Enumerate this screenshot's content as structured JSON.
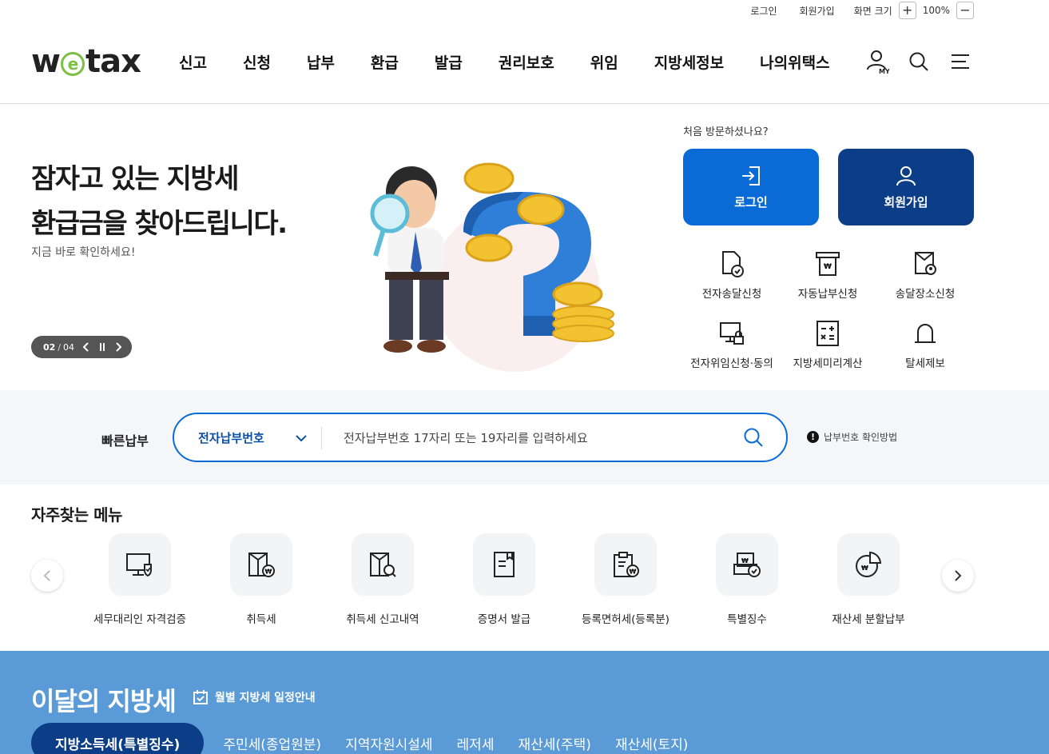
{
  "utility": {
    "login": "로그인",
    "signup": "회원가입",
    "zoom_label": "화면 크기",
    "zoom_in": "+",
    "zoom_value": "100%",
    "zoom_out": "−"
  },
  "header": {
    "logo_left": "w",
    "logo_e": "e",
    "logo_right": "tax",
    "nav": [
      "신고",
      "신청",
      "납부",
      "환급",
      "발급",
      "권리보호",
      "위임",
      "지방세정보",
      "나의위택스"
    ],
    "icons": [
      "my-page-icon",
      "search-icon",
      "menu-icon"
    ],
    "my_label": "MY"
  },
  "hero": {
    "title_line1": "잠자고 있는 지방세",
    "title_line2": "환급금을 찾아드립니다.",
    "subtitle": "지금 바로 확인하세요!",
    "pager_current": "02",
    "pager_sep": "/",
    "pager_total": "04"
  },
  "login_panel": {
    "first_visit": "처음 방문하셨나요?",
    "login_button": "로그인",
    "join_button": "회원가입"
  },
  "services": [
    {
      "label": "전자송달신청",
      "icon": "document-check-icon"
    },
    {
      "label": "자동납부신청",
      "icon": "auto-pay-icon"
    },
    {
      "label": "송달장소신청",
      "icon": "location-doc-icon"
    },
    {
      "label": "전자위임신청·동의",
      "icon": "monitor-lock-icon"
    },
    {
      "label": "지방세미리계산",
      "icon": "calculator-icon"
    },
    {
      "label": "탈세제보",
      "icon": "siren-icon"
    }
  ],
  "quick_pay": {
    "label": "빠른납부",
    "select_value": "전자납부번호",
    "placeholder": "전자납부번호 17자리 또는 19자리를 입력하세요",
    "help": "납부번호 확인방법"
  },
  "frequent": {
    "title": "자주찾는 메뉴",
    "items": [
      {
        "label": "세무대리인 자격검증",
        "icon": "monitor-shield-icon"
      },
      {
        "label": "취득세",
        "icon": "acquisition-tax-icon"
      },
      {
        "label": "취득세 신고내역",
        "icon": "acquisition-history-icon"
      },
      {
        "label": "증명서 발급",
        "icon": "certificate-icon"
      },
      {
        "label": "등록면허세(등록분)",
        "icon": "registration-tax-icon"
      },
      {
        "label": "특별징수",
        "icon": "special-collection-icon"
      },
      {
        "label": "재산세 분할납부",
        "icon": "installment-pie-icon"
      }
    ]
  },
  "monthly": {
    "title": "이달의 지방세",
    "calendar_link": "월별 지방세 일정안내",
    "tabs": [
      "지방소득세(특별징수)",
      "주민세(종업원분)",
      "지역자원시설세",
      "레저세",
      "재산세(주택)",
      "재산세(토지)"
    ]
  },
  "colors": {
    "primary_blue": "#0a6bd6",
    "navy": "#0c3e88",
    "monthly_bg": "#5a9ad6",
    "logo_green": "#7bc043"
  }
}
